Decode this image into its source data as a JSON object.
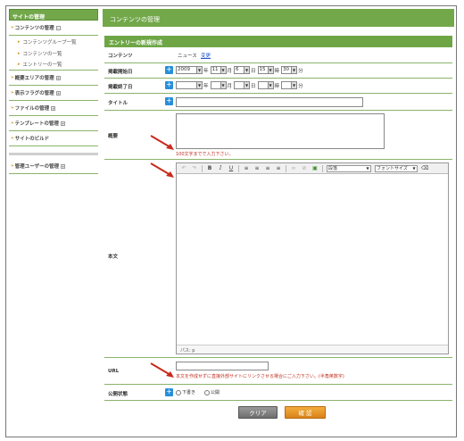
{
  "sidebar": {
    "header": "サイトの管理",
    "content_menu": {
      "label": "コンテンツの管理",
      "toggle": "-"
    },
    "content_sub": [
      "コンテンツグループ一覧",
      "コンテンツの一覧",
      "エントリーの一覧"
    ],
    "menus": [
      {
        "label": "概要エリアの管理",
        "toggle": "+"
      },
      {
        "label": "表示フラグの管理",
        "toggle": "+"
      },
      {
        "label": "ファイルの管理",
        "toggle": "+"
      },
      {
        "label": "テンプレートの管理",
        "toggle": "+"
      },
      {
        "label": "サイトのビルド",
        "toggle": ""
      }
    ],
    "admin_menu": {
      "label": "管理ユーザーの管理",
      "toggle": "+"
    }
  },
  "main": {
    "title": "コンテンツの管理",
    "subtitle": "エントリーの新規作成"
  },
  "form": {
    "content": {
      "label": "コンテンツ",
      "value": "ニュース",
      "link": "変更"
    },
    "start": {
      "label": "掲載開始日",
      "year": "2009",
      "year_unit": "年",
      "month": "11",
      "month_unit": "月",
      "day": "6",
      "day_unit": "日",
      "hour": "15",
      "hour_unit": "時",
      "minute": "30",
      "minute_unit": "分"
    },
    "end": {
      "label": "掲載終了日",
      "year_unit": "年",
      "month_unit": "月",
      "day_unit": "日",
      "hour_unit": "時",
      "minute_unit": "分"
    },
    "title": {
      "label": "タイトル"
    },
    "summary": {
      "label": "概要",
      "help": "100文字までで入力下さい。"
    },
    "body": {
      "label": "本文",
      "format_value": "段落",
      "font_size_value": "フォントサイズ",
      "path": "パス: p"
    },
    "url": {
      "label": "URL",
      "help": "本文を作成せずに直接外部サイトにリンクさせる場合にご入力下さい。(半角英数字)"
    },
    "status": {
      "label": "公開状態",
      "option_draft": "下書き",
      "option_public": "公開"
    }
  },
  "buttons": {
    "clear": "クリア",
    "confirm": "確 認"
  },
  "colors": {
    "green": "#72a84a",
    "orange": "#e2911f",
    "help_red": "#c03020",
    "plus_blue": "#2a8fd8"
  }
}
